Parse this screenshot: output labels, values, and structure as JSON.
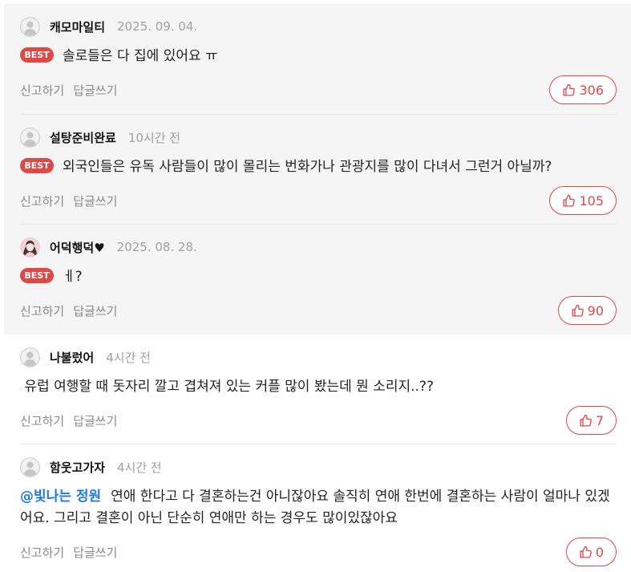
{
  "colors": {
    "accent": "#e04848",
    "mention": "#1f7ae0",
    "best_area_background": "#f5f5f5"
  },
  "icons": {
    "avatar_default": "default-profile-icon",
    "like": "thumbs-up-icon"
  },
  "comments": [
    {
      "user": "캐모마일티",
      "date": "2025. 09. 04.",
      "badge": "BEST",
      "text": "솔로들은 다 집에 있어요 ㅠ",
      "report": "신고하기",
      "reply": "답글쓰기",
      "likes": 306
    },
    {
      "user": "설탕준비완료",
      "date": "10시간 전",
      "badge": "BEST",
      "text": "외국인들은 유독 사람들이 많이 몰리는 번화가나 관광지를 많이 다녀서 그런거 아닐까?",
      "report": "신고하기",
      "reply": "답글쓰기",
      "likes": 105
    },
    {
      "user": "어덕행덕♥",
      "date": "2025. 08. 28.",
      "badge": "BEST",
      "text": "ㅔ?",
      "report": "신고하기",
      "reply": "답글쓰기",
      "likes": 90
    },
    {
      "user": "나불렀어",
      "date": "4시간 전",
      "text": " 유럽 여행할 때 돗자리 깔고 겹쳐져 있는 커플 많이 봤는데 뭔 소리지..??",
      "report": "신고하기",
      "reply": "답글쓰기",
      "likes": 7
    },
    {
      "user": "함웃고가자",
      "date": "4시간 전",
      "mention": "@빛나는 정원",
      "text": "연애 한다고 다 결혼하는건 아니잖아요 솔직히 연애 한번에 결혼하는 사람이 얼마나 있겠어요. 그리고 결혼이 아닌 단순히 연애만 하는 경우도 많이있잖아요",
      "report": "신고하기",
      "reply": "답글쓰기",
      "likes": 0
    }
  ]
}
